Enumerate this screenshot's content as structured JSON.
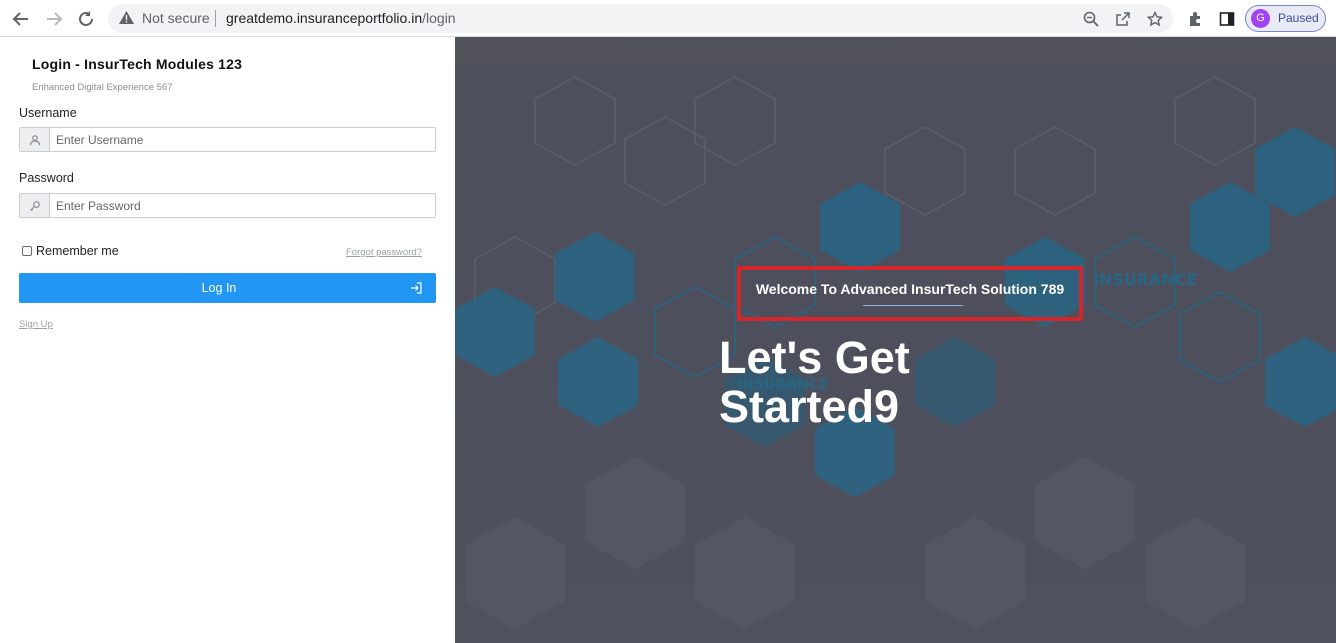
{
  "browser": {
    "security_label": "Not secure",
    "url_host": "greatdemo.insuranceportfolio.in",
    "url_path": "/login",
    "profile_initial": "G",
    "profile_status": "Paused"
  },
  "login": {
    "title": "Login - InsurTech Modules 123",
    "subtitle": "Enhanced Digital Experience 567",
    "username_label": "Username",
    "username_placeholder": "Enter Username",
    "password_label": "Password",
    "password_placeholder": "Enter Password",
    "remember_label": "Remember me",
    "remember_checked": false,
    "forgot_label": "Forgot password?",
    "login_button": "Log In",
    "signup_label": "Sign Up"
  },
  "hero": {
    "welcome": "Welcome To Advanced InsurTech Solution 789",
    "headline_line1": "Let's Get",
    "headline_line2": "Started9",
    "background_badges": [
      "INSURANCE",
      "INSURANCE"
    ]
  },
  "colors": {
    "primary": "#2196f3",
    "highlight_border": "#d7262b",
    "hero_bg": "#4b4e5a",
    "hex_blue": "#1f6f94"
  }
}
